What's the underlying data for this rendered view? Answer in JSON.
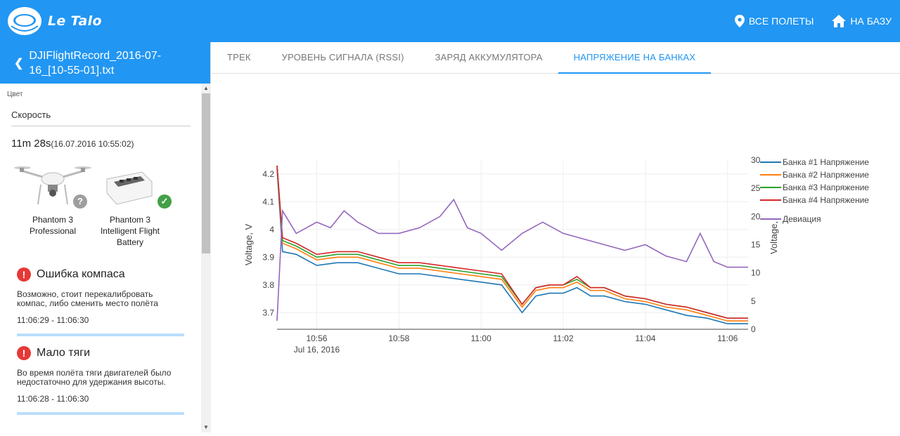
{
  "app": {
    "brand": "Le Talo"
  },
  "header": {
    "all_flights": "ВСЕ ПОЛЕТЫ",
    "home": "НА БАЗУ"
  },
  "sidebar": {
    "file_name": "DJIFlightRecord_2016-07-16_[10-55-01].txt",
    "color_label": "Цвет",
    "color_select_value": "Скорость",
    "duration": "11m 28s",
    "start_time": "(16.07.2016 10:55:02)",
    "devices": [
      {
        "name": "Phantom 3 Professional",
        "status": "unknown"
      },
      {
        "name": "Phantom 3 Intelligent Flight Battery",
        "status": "ok"
      }
    ],
    "alerts": [
      {
        "title": "Ошибка компаса",
        "description": "Возможно, стоит перекалибровать компас, либо сменить место полёта",
        "time": "11:06:29 - 11:06:30"
      },
      {
        "title": "Мало тяги",
        "description": "Во время полёта тяги двигателей было недостаточно для удержания высоты.",
        "time": "11:06:28 - 11:06:30"
      }
    ]
  },
  "tabs": [
    {
      "label": "ТРЕК",
      "active": false
    },
    {
      "label": "УРОВЕНЬ СИГНАЛА (RSSI)",
      "active": false
    },
    {
      "label": "ЗАРЯД АККУМУЛЯТОРА",
      "active": false
    },
    {
      "label": "НАПРЯЖЕНИЕ НА БАНКАХ",
      "active": true
    }
  ],
  "colors": {
    "accent": "#2196f3",
    "error": "#e53935",
    "ok": "#43a047"
  },
  "chart_data": {
    "type": "line",
    "ylabel": "Voltage, V",
    "y2label": "Voltage,",
    "ylim": [
      3.64,
      4.25
    ],
    "y2lim": [
      0,
      30
    ],
    "yticks": [
      "3.7",
      "3.8",
      "3.9",
      "4",
      "4.1",
      "4.2"
    ],
    "y2ticks": [
      "0",
      "5",
      "10",
      "15",
      "20",
      "25",
      "30"
    ],
    "xticks": [
      "10:56",
      "10:58",
      "11:00",
      "11:02",
      "11:04",
      "11:06"
    ],
    "xtick_sub": "Jul 16, 2016",
    "x_range": [
      "10:55:02",
      "11:06:30"
    ],
    "legend_position": "top-right",
    "series": [
      {
        "name": "Банка #1 Напряжение",
        "color": "#1f77b4",
        "axis": "y",
        "points": [
          [
            "10:55:02",
            4.22
          ],
          [
            "10:55:10",
            3.92
          ],
          [
            "10:55:30",
            3.91
          ],
          [
            "10:56:00",
            3.87
          ],
          [
            "10:56:30",
            3.88
          ],
          [
            "10:57:00",
            3.88
          ],
          [
            "10:57:30",
            3.86
          ],
          [
            "10:58:00",
            3.84
          ],
          [
            "10:58:30",
            3.84
          ],
          [
            "10:59:00",
            3.83
          ],
          [
            "10:59:30",
            3.82
          ],
          [
            "11:00:00",
            3.81
          ],
          [
            "11:00:30",
            3.8
          ],
          [
            "11:01:00",
            3.7
          ],
          [
            "11:01:20",
            3.76
          ],
          [
            "11:01:40",
            3.77
          ],
          [
            "11:02:00",
            3.77
          ],
          [
            "11:02:20",
            3.79
          ],
          [
            "11:02:40",
            3.76
          ],
          [
            "11:03:00",
            3.76
          ],
          [
            "11:03:30",
            3.74
          ],
          [
            "11:04:00",
            3.73
          ],
          [
            "11:04:30",
            3.71
          ],
          [
            "11:05:00",
            3.69
          ],
          [
            "11:05:30",
            3.68
          ],
          [
            "11:06:00",
            3.66
          ],
          [
            "11:06:30",
            3.66
          ]
        ]
      },
      {
        "name": "Банка #2 Напряжение",
        "color": "#ff7f0e",
        "axis": "y",
        "points": [
          [
            "10:55:02",
            4.23
          ],
          [
            "10:55:10",
            3.95
          ],
          [
            "10:55:30",
            3.93
          ],
          [
            "10:56:00",
            3.89
          ],
          [
            "10:56:30",
            3.9
          ],
          [
            "10:57:00",
            3.9
          ],
          [
            "10:57:30",
            3.88
          ],
          [
            "10:58:00",
            3.86
          ],
          [
            "10:58:30",
            3.86
          ],
          [
            "10:59:00",
            3.85
          ],
          [
            "10:59:30",
            3.84
          ],
          [
            "11:00:00",
            3.83
          ],
          [
            "11:00:30",
            3.82
          ],
          [
            "11:01:00",
            3.72
          ],
          [
            "11:01:20",
            3.78
          ],
          [
            "11:01:40",
            3.79
          ],
          [
            "11:02:00",
            3.79
          ],
          [
            "11:02:20",
            3.81
          ],
          [
            "11:02:40",
            3.78
          ],
          [
            "11:03:00",
            3.78
          ],
          [
            "11:03:30",
            3.75
          ],
          [
            "11:04:00",
            3.74
          ],
          [
            "11:04:30",
            3.72
          ],
          [
            "11:05:00",
            3.71
          ],
          [
            "11:05:30",
            3.69
          ],
          [
            "11:06:00",
            3.67
          ],
          [
            "11:06:30",
            3.67
          ]
        ]
      },
      {
        "name": "Банка #3 Напряжение",
        "color": "#2ca02c",
        "axis": "y",
        "points": [
          [
            "10:55:02",
            4.23
          ],
          [
            "10:55:10",
            3.96
          ],
          [
            "10:55:30",
            3.94
          ],
          [
            "10:56:00",
            3.9
          ],
          [
            "10:56:30",
            3.91
          ],
          [
            "10:57:00",
            3.91
          ],
          [
            "10:57:30",
            3.89
          ],
          [
            "10:58:00",
            3.87
          ],
          [
            "10:58:30",
            3.87
          ],
          [
            "10:59:00",
            3.86
          ],
          [
            "10:59:30",
            3.85
          ],
          [
            "11:00:00",
            3.84
          ],
          [
            "11:00:30",
            3.83
          ],
          [
            "11:01:00",
            3.73
          ],
          [
            "11:01:20",
            3.79
          ],
          [
            "11:01:40",
            3.8
          ],
          [
            "11:02:00",
            3.8
          ],
          [
            "11:02:20",
            3.82
          ],
          [
            "11:02:40",
            3.79
          ],
          [
            "11:03:00",
            3.79
          ],
          [
            "11:03:30",
            3.76
          ],
          [
            "11:04:00",
            3.75
          ],
          [
            "11:04:30",
            3.73
          ],
          [
            "11:05:00",
            3.72
          ],
          [
            "11:05:30",
            3.7
          ],
          [
            "11:06:00",
            3.68
          ],
          [
            "11:06:30",
            3.68
          ]
        ]
      },
      {
        "name": "Банка #4 Напряжение",
        "color": "#d62728",
        "axis": "y",
        "points": [
          [
            "10:55:02",
            4.23
          ],
          [
            "10:55:10",
            3.97
          ],
          [
            "10:55:30",
            3.95
          ],
          [
            "10:56:00",
            3.91
          ],
          [
            "10:56:30",
            3.92
          ],
          [
            "10:57:00",
            3.92
          ],
          [
            "10:57:30",
            3.9
          ],
          [
            "10:58:00",
            3.88
          ],
          [
            "10:58:30",
            3.88
          ],
          [
            "10:59:00",
            3.87
          ],
          [
            "10:59:30",
            3.86
          ],
          [
            "11:00:00",
            3.85
          ],
          [
            "11:00:30",
            3.84
          ],
          [
            "11:01:00",
            3.73
          ],
          [
            "11:01:20",
            3.79
          ],
          [
            "11:01:40",
            3.8
          ],
          [
            "11:02:00",
            3.8
          ],
          [
            "11:02:20",
            3.83
          ],
          [
            "11:02:40",
            3.79
          ],
          [
            "11:03:00",
            3.79
          ],
          [
            "11:03:30",
            3.76
          ],
          [
            "11:04:00",
            3.75
          ],
          [
            "11:04:30",
            3.73
          ],
          [
            "11:05:00",
            3.72
          ],
          [
            "11:05:30",
            3.7
          ],
          [
            "11:06:00",
            3.68
          ],
          [
            "11:06:30",
            3.68
          ]
        ]
      },
      {
        "name": "Девиация",
        "color": "#9467bd",
        "axis": "y2",
        "points": [
          [
            "10:55:02",
            1.5
          ],
          [
            "10:55:10",
            21
          ],
          [
            "10:55:30",
            17
          ],
          [
            "10:56:00",
            19
          ],
          [
            "10:56:20",
            18
          ],
          [
            "10:56:40",
            21
          ],
          [
            "10:57:00",
            19
          ],
          [
            "10:57:30",
            17
          ],
          [
            "10:58:00",
            17
          ],
          [
            "10:58:30",
            18
          ],
          [
            "10:59:00",
            20
          ],
          [
            "10:59:20",
            23
          ],
          [
            "10:59:40",
            18
          ],
          [
            "11:00:00",
            17
          ],
          [
            "11:00:30",
            14
          ],
          [
            "11:01:00",
            17
          ],
          [
            "11:01:30",
            19
          ],
          [
            "11:02:00",
            17
          ],
          [
            "11:02:30",
            16
          ],
          [
            "11:03:00",
            15
          ],
          [
            "11:03:30",
            14
          ],
          [
            "11:04:00",
            15
          ],
          [
            "11:04:30",
            13
          ],
          [
            "11:05:00",
            12
          ],
          [
            "11:05:20",
            17
          ],
          [
            "11:05:40",
            12
          ],
          [
            "11:06:00",
            11
          ],
          [
            "11:06:30",
            11
          ]
        ]
      }
    ]
  }
}
